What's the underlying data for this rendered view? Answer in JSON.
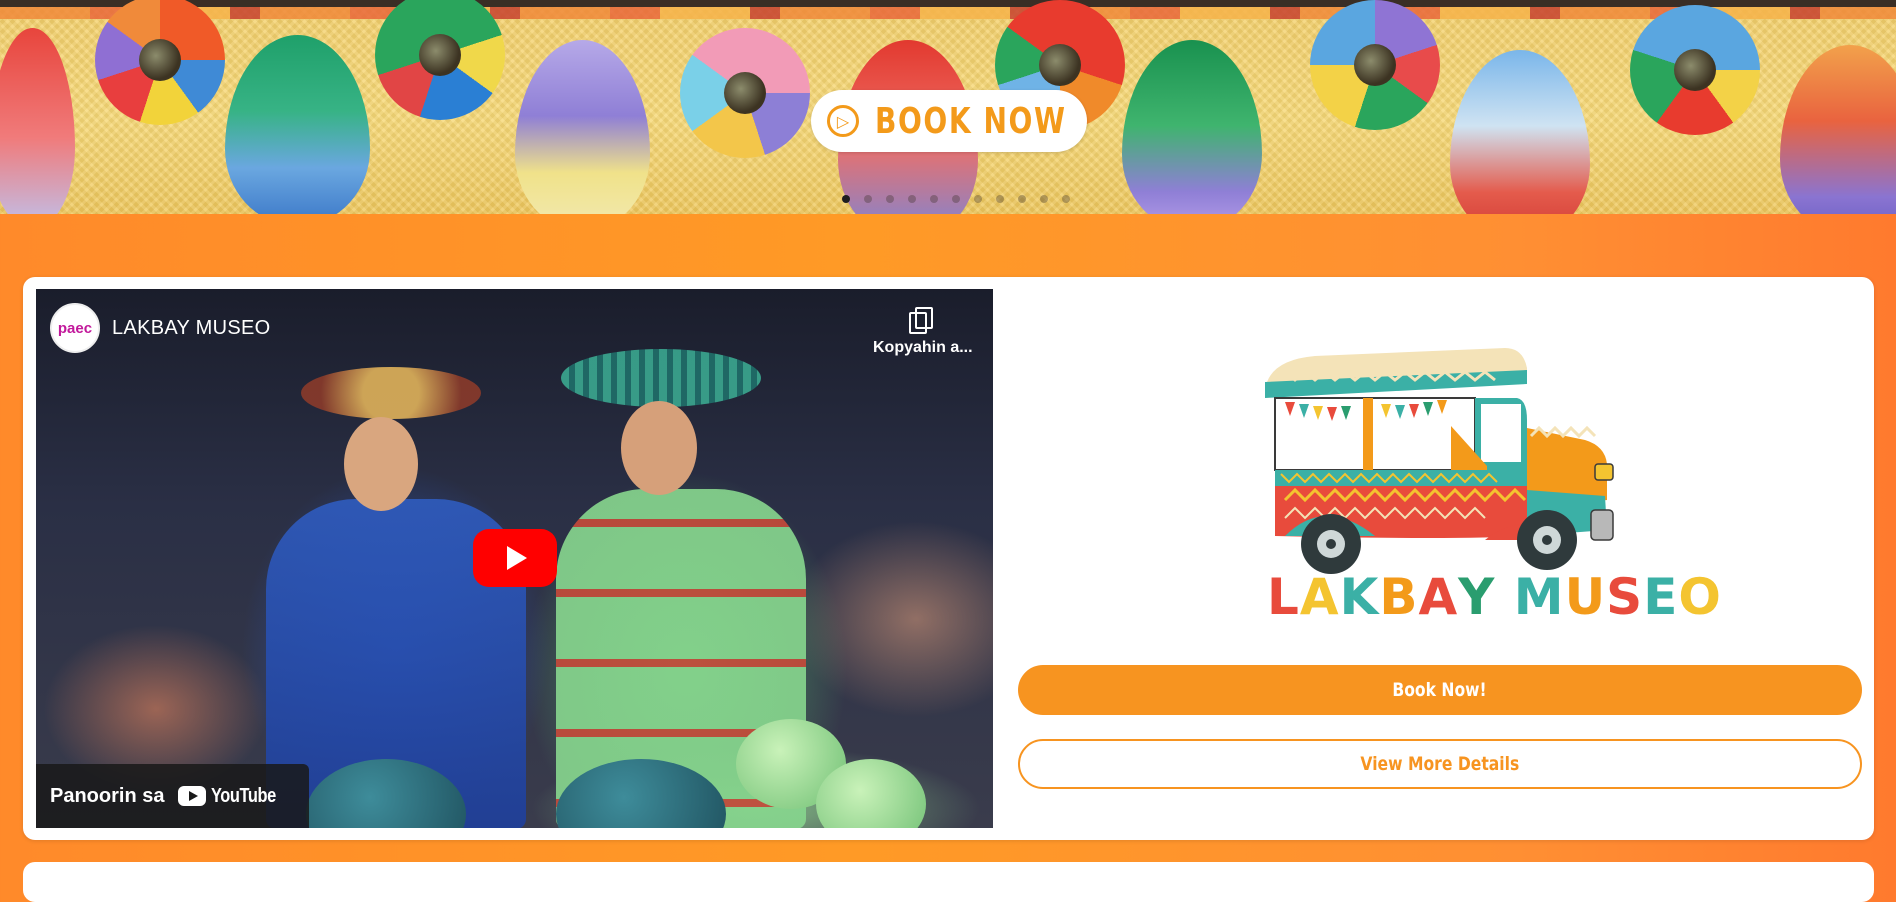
{
  "hero": {
    "cta_label": "BOOK NOW",
    "cta_icon": "play-circle-icon",
    "carousel_dot_count": 11,
    "carousel_active_index": 0
  },
  "video": {
    "channel_avatar_text": "paec",
    "title": "LAKBAY MUSEO",
    "copy_label": "Kopyahin a...",
    "watch_on_label": "Panoorin sa",
    "platform_label": "YouTube"
  },
  "brand": {
    "logo_text": "LAKBAY MUSEO"
  },
  "actions": {
    "book_label": "Book Now!",
    "details_label": "View More Details"
  },
  "colors": {
    "accent": "#f79420",
    "background": "#ff8f2a",
    "youtube_red": "#ff0000"
  }
}
